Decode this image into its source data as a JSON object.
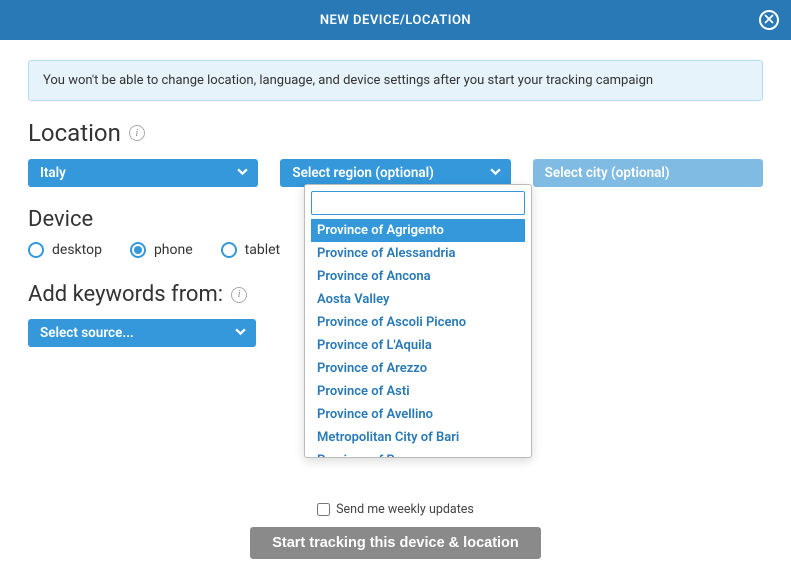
{
  "header": {
    "title": "NEW DEVICE/LOCATION"
  },
  "banner": {
    "text": "You won't be able to change location, language, and device settings after you start your tracking campaign"
  },
  "location": {
    "title": "Location",
    "country": "Italy",
    "region_placeholder": "Select region (optional)",
    "city_placeholder": "Select city (optional)"
  },
  "region_options": [
    "Province of Agrigento",
    "Province of Alessandria",
    "Province of Ancona",
    "Aosta Valley",
    "Province of Ascoli Piceno",
    "Province of L'Aquila",
    "Province of Arezzo",
    "Province of Asti",
    "Province of Avellino",
    "Metropolitan City of Bari",
    "Province of Bergamo"
  ],
  "region_selected_index": 0,
  "device": {
    "title": "Device",
    "options": [
      "desktop",
      "phone",
      "tablet"
    ],
    "selected": "phone"
  },
  "keywords": {
    "title": "Add keywords from:",
    "source_placeholder": "Select source..."
  },
  "footer": {
    "weekly_label": "Send me weekly updates",
    "start_label": "Start tracking this device & location"
  }
}
